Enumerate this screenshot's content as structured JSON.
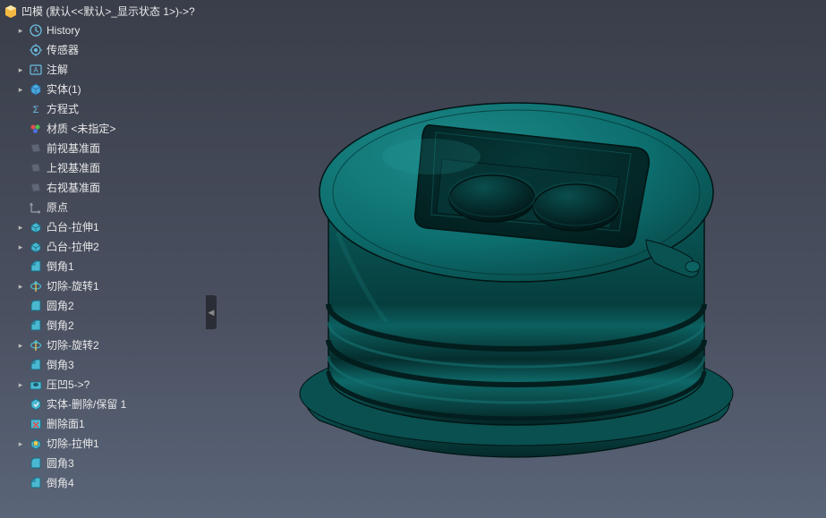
{
  "root": {
    "label": "凹模  (默认<<默认>_显示状态 1>)->?"
  },
  "items": [
    {
      "icon": "history",
      "label": "History",
      "expandable": true
    },
    {
      "icon": "sensor",
      "label": "传感器",
      "expandable": false
    },
    {
      "icon": "annotation",
      "label": "注解",
      "expandable": true
    },
    {
      "icon": "solid",
      "label": "实体(1)",
      "expandable": true
    },
    {
      "icon": "equation",
      "label": "方程式",
      "expandable": false
    },
    {
      "icon": "material",
      "label": "材质 <未指定>",
      "expandable": false
    },
    {
      "icon": "plane",
      "label": "前视基准面",
      "expandable": false
    },
    {
      "icon": "plane",
      "label": "上视基准面",
      "expandable": false
    },
    {
      "icon": "plane",
      "label": "右视基准面",
      "expandable": false
    },
    {
      "icon": "origin",
      "label": "原点",
      "expandable": false
    },
    {
      "icon": "extrude",
      "label": "凸台-拉伸1",
      "expandable": true
    },
    {
      "icon": "extrude",
      "label": "凸台-拉伸2",
      "expandable": true
    },
    {
      "icon": "chamfer",
      "label": "倒角1",
      "expandable": false
    },
    {
      "icon": "revolvecut",
      "label": "切除-旋转1",
      "expandable": true
    },
    {
      "icon": "fillet",
      "label": "圆角2",
      "expandable": false
    },
    {
      "icon": "chamfer",
      "label": "倒角2",
      "expandable": false
    },
    {
      "icon": "revolvecut",
      "label": "切除-旋转2",
      "expandable": true
    },
    {
      "icon": "chamfer",
      "label": "倒角3",
      "expandable": false
    },
    {
      "icon": "indent",
      "label": "压凹5->?",
      "expandable": true
    },
    {
      "icon": "bodykeep",
      "label": "实体-删除/保留 1",
      "expandable": false
    },
    {
      "icon": "deleteface",
      "label": "删除面1",
      "expandable": false
    },
    {
      "icon": "extrudecut",
      "label": "切除-拉伸1",
      "expandable": true
    },
    {
      "icon": "fillet",
      "label": "圆角3",
      "expandable": false
    },
    {
      "icon": "chamfer",
      "label": "倒角4",
      "expandable": false
    }
  ],
  "collapse_arrow": "◀"
}
